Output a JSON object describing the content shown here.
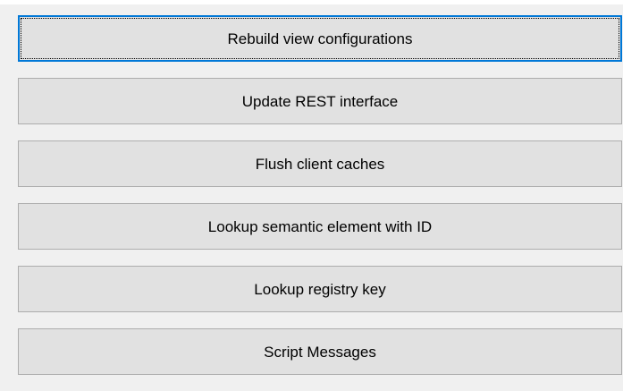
{
  "buttons": [
    {
      "label": "Rebuild view configurations",
      "focused": true
    },
    {
      "label": "Update REST interface",
      "focused": false
    },
    {
      "label": "Flush client caches",
      "focused": false
    },
    {
      "label": "Lookup semantic element with ID",
      "focused": false
    },
    {
      "label": "Lookup registry key",
      "focused": false
    },
    {
      "label": "Script Messages",
      "focused": false
    }
  ],
  "colors": {
    "background": "#f0f0f0",
    "button_face": "#e1e1e1",
    "button_border": "#adadad",
    "focus_border": "#0078d7"
  }
}
